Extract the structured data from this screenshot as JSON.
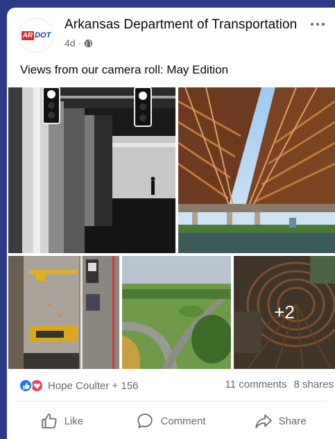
{
  "post": {
    "page_name": "Arkansas Department of Transportation",
    "logo_ar": "AR",
    "logo_dot": "DOT",
    "time": "4d",
    "separator": "·",
    "text": "Views from our camera roll: May Edition"
  },
  "photos": {
    "extra_count": "+2"
  },
  "reactions": {
    "names": "Hope Coulter + 156",
    "comments": "11 comments",
    "shares": "8 shares"
  },
  "actions": {
    "like": "Like",
    "comment": "Comment",
    "share": "Share"
  },
  "colors": {
    "background": "#2b3a86",
    "like_blue": "#1877f2",
    "love_red": "#f33e58",
    "muted_text": "#65676b"
  },
  "icons": [
    "globe-icon",
    "more-options-icon",
    "like-reaction-icon",
    "love-reaction-icon",
    "thumbs-up-icon",
    "comment-bubble-icon",
    "share-arrow-icon"
  ]
}
